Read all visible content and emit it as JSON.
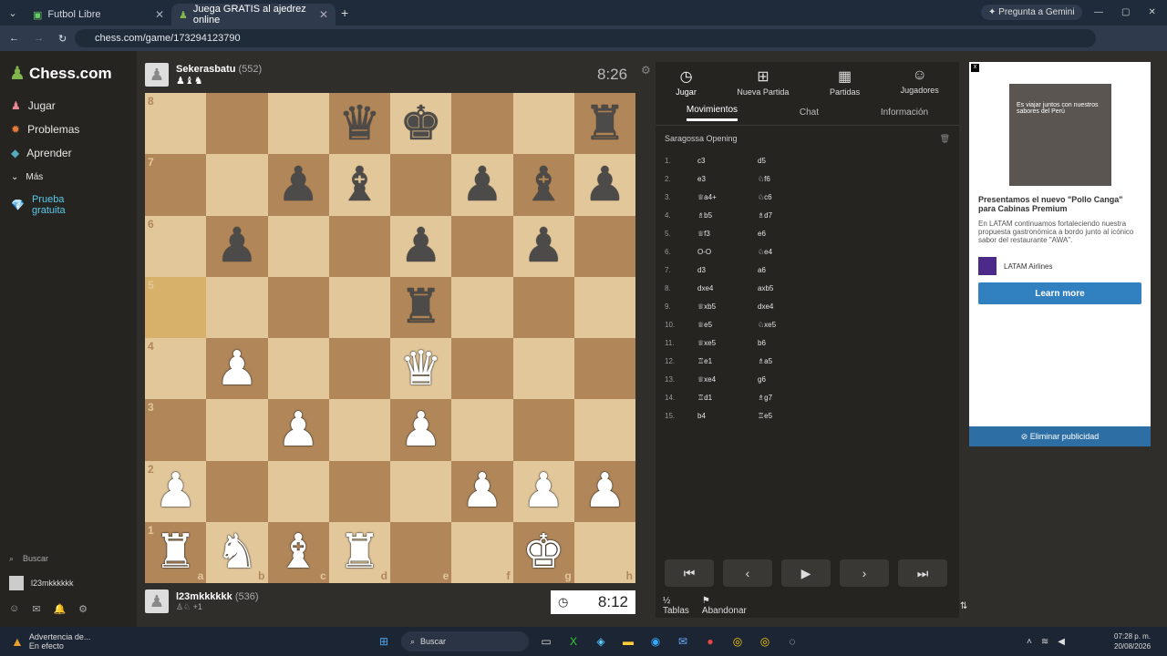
{
  "browser": {
    "tabs": [
      {
        "label": "Futbol Libre"
      },
      {
        "label": "Juega GRATIS al ajedrez online"
      }
    ],
    "url": "chess.com/game/173294123790",
    "gemini": "Pregunta a Gemini"
  },
  "sidebar": {
    "logo": "Chess.com",
    "items": [
      {
        "label": "Jugar"
      },
      {
        "label": "Problemas"
      },
      {
        "label": "Aprender"
      },
      {
        "label": "Más"
      },
      {
        "label": "Prueba gratuita"
      }
    ],
    "search": "Buscar",
    "user": "l23mkkkkkk"
  },
  "top_player": {
    "name": "Sekerasbatu",
    "rating": "(552)",
    "clock": "8:26"
  },
  "bottom_player": {
    "name": "l23mkkkkkk",
    "rating": "(536)",
    "extra": "+1",
    "clock": "8:12"
  },
  "board": {
    "ranks": [
      "8",
      "7",
      "6",
      "5",
      "4",
      "3",
      "2",
      "1"
    ],
    "files": [
      "a",
      "b",
      "c",
      "d",
      "e",
      "f",
      "g",
      "h"
    ],
    "position": [
      [
        "",
        "",
        "",
        "bq",
        "bk",
        "",
        "",
        "br"
      ],
      [
        "",
        "",
        "bp",
        "bb",
        "",
        "bp",
        "bb",
        "bp"
      ],
      [
        "",
        "bp",
        "",
        "",
        "bp",
        "",
        "bp",
        ""
      ],
      [
        "",
        "",
        "",
        "",
        "br",
        "",
        "",
        ""
      ],
      [
        "",
        "wp",
        "",
        "",
        "wq",
        "",
        "",
        ""
      ],
      [
        "",
        "",
        "wp",
        "",
        "wp",
        "",
        "",
        ""
      ],
      [
        "wp",
        "",
        "",
        "",
        "",
        "wp",
        "wp",
        "wp"
      ],
      [
        "wr",
        "wn",
        "wb",
        "wr",
        "",
        "",
        "wk",
        ""
      ]
    ],
    "highlight_square": "a5"
  },
  "panel": {
    "tabs": [
      {
        "label": "Jugar"
      },
      {
        "label": "Nueva Partida"
      },
      {
        "label": "Partidas"
      },
      {
        "label": "Jugadores"
      }
    ],
    "subtabs": [
      {
        "label": "Movimientos"
      },
      {
        "label": "Chat"
      },
      {
        "label": "Información"
      }
    ],
    "opening": "Saragossa Opening",
    "moves": [
      {
        "n": "1.",
        "w": "c3",
        "b": "d5"
      },
      {
        "n": "2.",
        "w": "e3",
        "b": "♘f6"
      },
      {
        "n": "3.",
        "w": "♕a4+",
        "b": "♘c6"
      },
      {
        "n": "4.",
        "w": "♗b5",
        "b": "♗d7"
      },
      {
        "n": "5.",
        "w": "♕f3",
        "b": "e6"
      },
      {
        "n": "6.",
        "w": "O-O",
        "b": "♘e4"
      },
      {
        "n": "7.",
        "w": "d3",
        "b": "a6"
      },
      {
        "n": "8.",
        "w": "dxe4",
        "b": "axb5"
      },
      {
        "n": "9.",
        "w": "♕xb5",
        "b": "dxe4"
      },
      {
        "n": "10.",
        "w": "♕e5",
        "b": "♘xe5"
      },
      {
        "n": "11.",
        "w": "♕xe5",
        "b": "b6"
      },
      {
        "n": "12.",
        "w": "♖e1",
        "b": "♗a5"
      },
      {
        "n": "13.",
        "w": "♕xe4",
        "b": "g6"
      },
      {
        "n": "14.",
        "w": "♖d1",
        "b": "♗g7"
      },
      {
        "n": "15.",
        "w": "b4",
        "b": "♖e5"
      }
    ],
    "footer": {
      "tablas": "Tablas",
      "abandonar": "Abandonar"
    }
  },
  "ad": {
    "image_text": "Es viajar juntos con nuestros sabores del Perú",
    "title": "Presentamos el nuevo \"Pollo Canga\" para Cabinas Premium",
    "text": "En LATAM continuamos fortaleciendo nuestra propuesta gastronómica a bordo junto al icónico sabor del restaurante \"AWA\".",
    "brand": "LATAM Airlines",
    "cta": "Learn more",
    "remove": "Eliminar publicidad"
  },
  "taskbar": {
    "alert": "Advertencia de...",
    "alert_sub": "En efecto",
    "search": "Buscar",
    "time": "07:28 p. m.",
    "date": "20/08/2026"
  }
}
